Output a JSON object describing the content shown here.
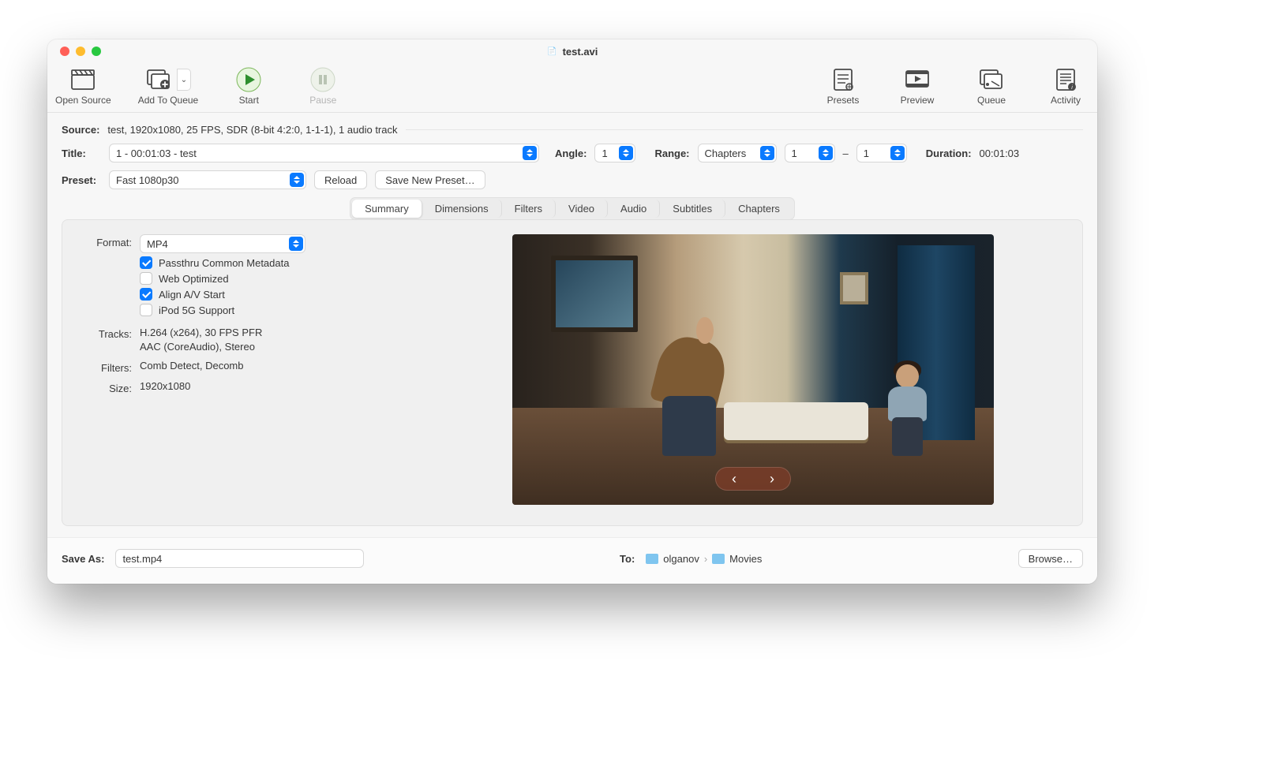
{
  "window": {
    "title": "test.avi"
  },
  "toolbar": {
    "open_source": "Open Source",
    "add_to_queue": "Add To Queue",
    "start": "Start",
    "pause": "Pause",
    "presets": "Presets",
    "preview": "Preview",
    "queue": "Queue",
    "activity": "Activity"
  },
  "source": {
    "label": "Source:",
    "value": "test, 1920x1080, 25 FPS, SDR (8-bit 4:2:0, 1-1-1), 1 audio track"
  },
  "title": {
    "label": "Title:",
    "value": "1 - 00:01:03 - test"
  },
  "angle": {
    "label": "Angle:",
    "value": "1"
  },
  "range": {
    "label": "Range:",
    "mode": "Chapters",
    "from": "1",
    "sep": "–",
    "to": "1"
  },
  "duration": {
    "label": "Duration:",
    "value": "00:01:03"
  },
  "preset": {
    "label": "Preset:",
    "value": "Fast 1080p30",
    "reload": "Reload",
    "save_new": "Save New Preset…"
  },
  "tabs": [
    "Summary",
    "Dimensions",
    "Filters",
    "Video",
    "Audio",
    "Subtitles",
    "Chapters"
  ],
  "summary": {
    "format_label": "Format:",
    "format_value": "MP4",
    "passthru": "Passthru Common Metadata",
    "web_opt": "Web Optimized",
    "align_av": "Align A/V Start",
    "ipod": "iPod 5G Support",
    "tracks_label": "Tracks:",
    "tracks_line1": "H.264 (x264), 30 FPS PFR",
    "tracks_line2": "AAC (CoreAudio), Stereo",
    "filters_label": "Filters:",
    "filters_value": "Comb Detect, Decomb",
    "size_label": "Size:",
    "size_value": "1920x1080"
  },
  "save": {
    "label": "Save As:",
    "filename": "test.mp4",
    "to_label": "To:",
    "path_user": "olganov",
    "path_folder": "Movies",
    "browse": "Browse…"
  },
  "pager": {
    "prev": "‹",
    "next": "›"
  }
}
